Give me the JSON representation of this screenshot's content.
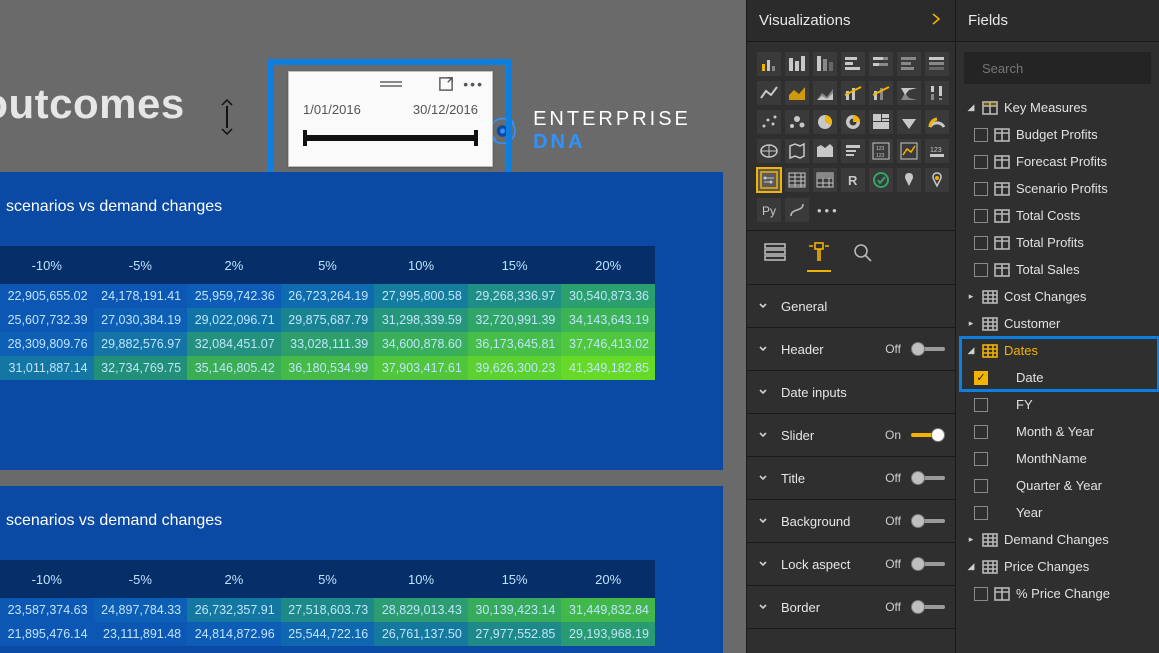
{
  "report": {
    "title_fragment": "est outcomes",
    "brand_main": "ENTERPRISE",
    "brand_sub": "DNA"
  },
  "slicer": {
    "start_date": "1/01/2016",
    "end_date": "30/12/2016"
  },
  "matrix1": {
    "title": "scenarios vs demand changes",
    "headers": [
      "-10%",
      "-5%",
      "2%",
      "5%",
      "10%",
      "15%",
      "20%"
    ],
    "rows": [
      [
        "22,905,655.02",
        "24,178,191.41",
        "25,959,742.36",
        "26,723,264.19",
        "27,995,800.58",
        "29,268,336.97",
        "30,540,873.36"
      ],
      [
        "25,607,732.39",
        "27,030,384.19",
        "29,022,096.71",
        "29,875,687.79",
        "31,298,339.59",
        "32,720,991.39",
        "34,143,643.19"
      ],
      [
        "28,309,809.76",
        "29,882,576.97",
        "32,084,451.07",
        "33,028,111.39",
        "34,600,878.60",
        "36,173,645.81",
        "37,746,413.02"
      ],
      [
        "31,011,887.14",
        "32,734,769.75",
        "35,146,805.42",
        "36,180,534.99",
        "37,903,417.61",
        "39,626,300.23",
        "41,349,182.85"
      ]
    ]
  },
  "matrix2": {
    "title": "scenarios vs demand changes",
    "headers": [
      "-10%",
      "-5%",
      "2%",
      "5%",
      "10%",
      "15%",
      "20%"
    ],
    "rows": [
      [
        "23,587,374.63",
        "24,897,784.33",
        "26,732,357.91",
        "27,518,603.73",
        "28,829,013.43",
        "30,139,423.14",
        "31,449,832.84"
      ],
      [
        "21,895,476.14",
        "23,111,891.48",
        "24,814,872.96",
        "25,544,722.16",
        "26,761,137.50",
        "27,977,552.85",
        "29,193,968.19"
      ]
    ]
  },
  "matrix1_colors": [
    [
      "#0d57b4",
      "#0d57b4",
      "#0d5db8",
      "#0e6bb0",
      "#147c9d",
      "#1f8f86",
      "#2aa06f"
    ],
    [
      "#0d57b4",
      "#0d5fb6",
      "#1073a6",
      "#19848f",
      "#27977b",
      "#31a567",
      "#3cb455"
    ],
    [
      "#0e60b6",
      "#1374a5",
      "#24917f",
      "#2e9f6b",
      "#3aaf59",
      "#46be47",
      "#50c83d"
    ],
    [
      "#1476a3",
      "#229079",
      "#3bad55",
      "#46ba46",
      "#51c63a",
      "#5cd12f",
      "#66da26"
    ]
  ],
  "matrix2_colors": [
    [
      "#0d57b4",
      "#0d5fb6",
      "#1477a2",
      "#1e8a87",
      "#2b9d70",
      "#37ab5c",
      "#42b84b"
    ],
    [
      "#0d57b4",
      "#0d57b4",
      "#0d5cb6",
      "#0f68af",
      "#15799e",
      "#1e8a87",
      "#299b72"
    ]
  ],
  "viz": {
    "header": "Visualizations",
    "tabs": {
      "fields": "fields",
      "format": "format",
      "analytics": "analytics"
    },
    "format": {
      "general": {
        "label": "General"
      },
      "header": {
        "label": "Header",
        "state": "Off"
      },
      "date_inputs": {
        "label": "Date inputs"
      },
      "slider": {
        "label": "Slider",
        "state": "On"
      },
      "title": {
        "label": "Title",
        "state": "Off"
      },
      "background": {
        "label": "Background",
        "state": "Off"
      },
      "lock_aspect": {
        "label": "Lock aspect",
        "state": "Off"
      },
      "border": {
        "label": "Border",
        "state": "Off"
      }
    }
  },
  "fields": {
    "header": "Fields",
    "search_placeholder": "Search",
    "tables": {
      "key_measures": {
        "label": "Key Measures",
        "items": [
          "Budget Profits",
          "Forecast Profits",
          "Scenario Profits",
          "Total Costs",
          "Total Profits",
          "Total Sales"
        ]
      },
      "cost_changes": {
        "label": "Cost Changes"
      },
      "customer": {
        "label": "Customer"
      },
      "dates": {
        "label": "Dates",
        "items": [
          "Date",
          "FY",
          "Month & Year",
          "MonthName",
          "Quarter & Year",
          "Year"
        ]
      },
      "demand_changes": {
        "label": "Demand Changes"
      },
      "price_changes": {
        "label": "Price Changes",
        "items": [
          "% Price Change"
        ]
      }
    }
  }
}
